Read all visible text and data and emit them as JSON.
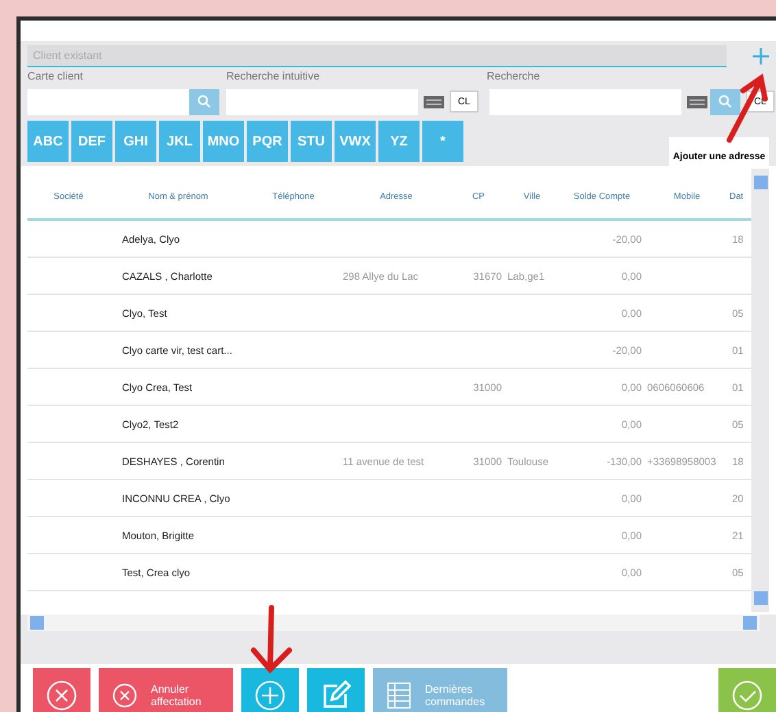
{
  "search_panel": {
    "existing_client": {
      "placeholder": "Client existant"
    },
    "fields": [
      {
        "kind": "card",
        "label": "Carte client"
      },
      {
        "kind": "intuitive",
        "label": "Recherche intuitive",
        "clear": "CL"
      },
      {
        "kind": "search",
        "label": "Recherche",
        "clear": "CL"
      }
    ],
    "alphabet": [
      "ABC",
      "DEF",
      "GHI",
      "JKL",
      "MNO",
      "PQR",
      "STU",
      "VWX",
      "YZ",
      "*"
    ],
    "tooltip": "Ajouter une adresse"
  },
  "table": {
    "columns": [
      "Société",
      "Nom & prénom",
      "Téléphone",
      "Adresse",
      "CP",
      "Ville",
      "Solde Compte",
      "Mobile",
      "Dat"
    ],
    "rows": [
      [
        "",
        "Adelya, Clyo",
        "",
        "",
        "",
        "",
        "-20,00",
        "",
        "18"
      ],
      [
        "",
        "CAZALS , Charlotte",
        "",
        "298 Allye du Lac",
        "31670",
        "Lab,ge1",
        "0,00",
        "",
        ""
      ],
      [
        "",
        "Clyo, Test",
        "",
        "",
        "",
        "",
        "0,00",
        "",
        "05"
      ],
      [
        "",
        "Clyo carte vir, test cart...",
        "",
        "",
        "",
        "",
        "-20,00",
        "",
        "01"
      ],
      [
        "",
        "Clyo Crea, Test",
        "",
        "",
        "31000",
        "",
        "0,00",
        "0606060606",
        "01"
      ],
      [
        "",
        "Clyo2, Test2",
        "",
        "",
        "",
        "",
        "0,00",
        "",
        "05"
      ],
      [
        "",
        "DESHAYES , Corentin",
        "",
        "11 avenue de test",
        "31000",
        "Toulouse",
        "-130,00",
        "+33698958003",
        "18"
      ],
      [
        "",
        "INCONNU CREA , Clyo",
        "",
        "",
        "",
        "",
        "0,00",
        "",
        "20"
      ],
      [
        "",
        "Mouton, Brigitte",
        "",
        "",
        "",
        "",
        "0,00",
        "",
        "21"
      ],
      [
        "",
        "Test, Crea clyo",
        "",
        "",
        "",
        "",
        "0,00",
        "",
        "05"
      ]
    ]
  },
  "actions": [
    {
      "kind": "close"
    },
    {
      "kind": "cancel",
      "label": "Annuler affectation"
    },
    {
      "kind": "add"
    },
    {
      "kind": "edit"
    },
    {
      "kind": "orders",
      "label": "Dernières commandes"
    },
    {
      "kind": "confirm"
    }
  ]
}
